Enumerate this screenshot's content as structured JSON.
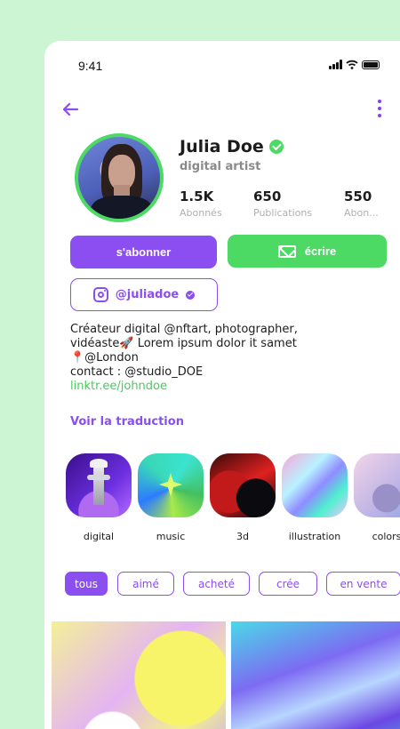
{
  "status_bar": {
    "time": "9:41"
  },
  "profile": {
    "name": "Julia Doe",
    "role": "digital artist",
    "stats": [
      {
        "value": "1.5K",
        "label": "Abonnés"
      },
      {
        "value": "650",
        "label": "Publications"
      },
      {
        "value": "550",
        "label": "Abon..."
      }
    ]
  },
  "actions": {
    "subscribe_label": "s'abonner",
    "write_label": "écrire",
    "instagram_handle": "@juliadoe"
  },
  "bio": {
    "line1": "Créateur digital @nftart, photographer,",
    "line2": "vidéaste🚀 Lorem ipsum dolor it samet",
    "line3": "📍@London",
    "line4": "contact : @studio_DOE",
    "link": "linktr.ee/johndoe",
    "translate_label": "Voir la traduction"
  },
  "categories": [
    {
      "label": "digital"
    },
    {
      "label": "music"
    },
    {
      "label": "3d"
    },
    {
      "label": "illustration"
    },
    {
      "label": "colors"
    }
  ],
  "filters": [
    {
      "label": "tous",
      "active": true
    },
    {
      "label": "aimé",
      "active": false
    },
    {
      "label": "acheté",
      "active": false
    },
    {
      "label": "crée",
      "active": false
    },
    {
      "label": "en vente",
      "active": false
    }
  ],
  "colors": {
    "background": "#ccf5d4",
    "accent_purple": "#8a4ef1",
    "accent_green": "#4cd964"
  }
}
